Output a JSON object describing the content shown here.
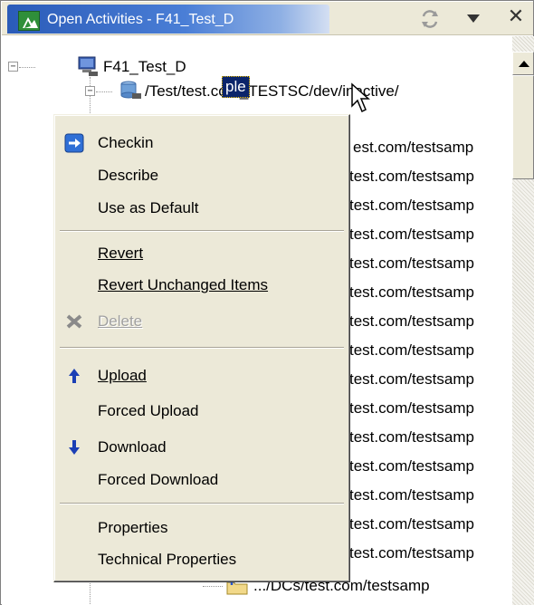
{
  "window": {
    "title": "Open Activities - F41_Test_D"
  },
  "tree": {
    "root_label": "F41_Test_D",
    "workspace_path": "/Test/test.com_TESTSC/dev/inactive/",
    "selected_node_label": "ple",
    "partial_rows": [
      "est.com/testsamp",
      "test.com/testsamp",
      "test.com/testsamp",
      "test.com/testsamp",
      "test.com/testsamp",
      "test.com/testsamp",
      "test.com/testsamp",
      "test.com/testsamp",
      "test.com/testsamp",
      "test.com/testsamp",
      "test.com/testsamp",
      "test.com/testsamp",
      "test.com/testsamp",
      "test.com/testsamp",
      "test.com/testsamp"
    ],
    "last_row_label": ".../DCs/test.com/testsamp"
  },
  "context_menu": {
    "checkin": {
      "label": "Checkin",
      "icon": "checkin-arrow-icon"
    },
    "describe": {
      "label": "Describe"
    },
    "use_as_default": {
      "label": "Use as Default"
    },
    "revert": {
      "label": "Revert"
    },
    "revert_unchanged": {
      "label": "Revert Unchanged Items"
    },
    "delete": {
      "label": "Delete",
      "icon": "delete-x-icon",
      "disabled": true
    },
    "upload": {
      "label": "Upload",
      "icon": "upload-arrow-icon"
    },
    "forced_upload": {
      "label": "Forced Upload"
    },
    "download": {
      "label": "Download",
      "icon": "download-arrow-icon"
    },
    "forced_download": {
      "label": "Forced Download"
    },
    "properties": {
      "label": "Properties"
    },
    "technical_properties": {
      "label": "Technical Properties"
    }
  },
  "colors": {
    "title_gradient_start": "#2a5bb8",
    "selection": "#0a246a",
    "menu_background": "#ece9d8",
    "disabled_text": "#a0a0a0"
  }
}
